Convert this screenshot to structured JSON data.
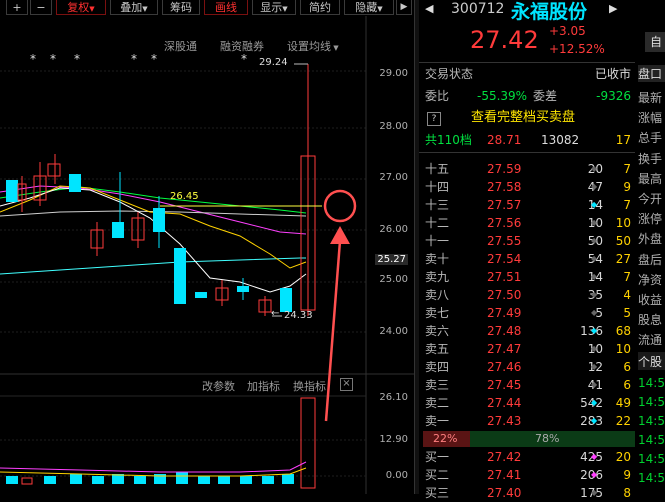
{
  "toolbar": {
    "items": [
      "+",
      "−",
      "复权",
      "叠加",
      "筹码",
      "画线",
      "显示",
      "简约",
      "隐藏"
    ],
    "active_index": 2
  },
  "subnav": {
    "sh_link": "深股通",
    "margin": "融资融券",
    "ma_settings": "设置均线"
  },
  "stars": [
    "*",
    "*",
    "*",
    "*",
    "*",
    "*"
  ],
  "chart": {
    "high_label": "29.24",
    "low_label": "24.33",
    "ma_label": "26.45",
    "current_price_tag": "25.27",
    "price_ticks": [
      "29.00",
      "28.00",
      "27.00",
      "26.00",
      "25.00",
      "24.00"
    ],
    "volume_ticks": [
      "26.10",
      "12.90",
      "0.00"
    ],
    "indicator_buttons": [
      "改参数",
      "加指标",
      "换指标"
    ],
    "close_glyph": "×"
  },
  "stock": {
    "code": "300712",
    "name": "永福股份",
    "price": "27.42",
    "change": "+3.05",
    "change_pct": "+12.52%",
    "side_button": "自"
  },
  "status": {
    "label": "交易状态",
    "value": "已收市",
    "side": "盘口",
    "weibi_label": "委比",
    "weibi_value": "-55.39%",
    "weicha_label": "委差",
    "weicha_value": "-9326",
    "help_icon": "?",
    "full_book_link": "查看完整档买卖盘"
  },
  "book_summary": {
    "label": "共110档",
    "price": "28.71",
    "volume": "13082",
    "count": "17"
  },
  "asks": [
    {
      "label": "十五",
      "price": "27.59",
      "vol": "20",
      "mark": "grey",
      "cnt": "7"
    },
    {
      "label": "十四",
      "price": "27.58",
      "vol": "47",
      "mark": "grey",
      "cnt": "9"
    },
    {
      "label": "十三",
      "price": "27.57",
      "vol": "14",
      "mark": "cyan",
      "cnt": "7"
    },
    {
      "label": "十二",
      "price": "27.56",
      "vol": "10",
      "mark": "grey",
      "cnt": "10"
    },
    {
      "label": "十一",
      "price": "27.55",
      "vol": "50",
      "mark": "grey",
      "cnt": "50"
    },
    {
      "label": "卖十",
      "price": "27.54",
      "vol": "54",
      "mark": "grey",
      "cnt": "27"
    },
    {
      "label": "卖九",
      "price": "27.51",
      "vol": "14",
      "mark": "grey",
      "cnt": "7"
    },
    {
      "label": "卖八",
      "price": "27.50",
      "vol": "35",
      "mark": "grey",
      "cnt": "4"
    },
    {
      "label": "卖七",
      "price": "27.49",
      "vol": "5",
      "mark": "grey",
      "cnt": "5"
    },
    {
      "label": "卖六",
      "price": "27.48",
      "vol": "136",
      "mark": "cyan",
      "cnt": "68"
    },
    {
      "label": "卖五",
      "price": "27.47",
      "vol": "10",
      "mark": "grey",
      "cnt": "10"
    },
    {
      "label": "卖四",
      "price": "27.46",
      "vol": "12",
      "mark": "grey",
      "cnt": "6"
    },
    {
      "label": "卖三",
      "price": "27.45",
      "vol": "41",
      "mark": "grey",
      "cnt": "6"
    },
    {
      "label": "卖二",
      "price": "27.44",
      "vol": "542",
      "mark": "cyan",
      "cnt": "49"
    },
    {
      "label": "卖一",
      "price": "27.43",
      "vol": "283",
      "mark": "cyan",
      "cnt": "22"
    }
  ],
  "ratio": {
    "sell_pct": "22%",
    "buy_pct": "78%",
    "sell_fraction": 0.22
  },
  "bids": [
    {
      "label": "买一",
      "price": "27.42",
      "vol": "425",
      "mark": "magenta",
      "cnt": "20"
    },
    {
      "label": "买二",
      "price": "27.41",
      "vol": "206",
      "mark": "magenta",
      "cnt": "9"
    },
    {
      "label": "买三",
      "price": "27.40",
      "vol": "175",
      "mark": "grey",
      "cnt": "8"
    }
  ],
  "side_labels": [
    "最新",
    "涨幅",
    "总手",
    "换手",
    "最高",
    "今开",
    "涨停",
    "外盘",
    "盘后",
    "净资",
    "收益",
    "股息",
    "流通"
  ],
  "side_section": "个股",
  "side_times": [
    "14:5",
    "14:5",
    "14:5",
    "14:5",
    "14:5",
    "14:5"
  ],
  "colors": {
    "up": "#ff3b3b",
    "down": "#00e5ff",
    "ma5": "#ffffff",
    "ma10": "#ffd200",
    "ma20": "#ff40ff",
    "ma30": "#00ff40",
    "ma60": "#40ffff",
    "annotation": "#ff5050"
  }
}
